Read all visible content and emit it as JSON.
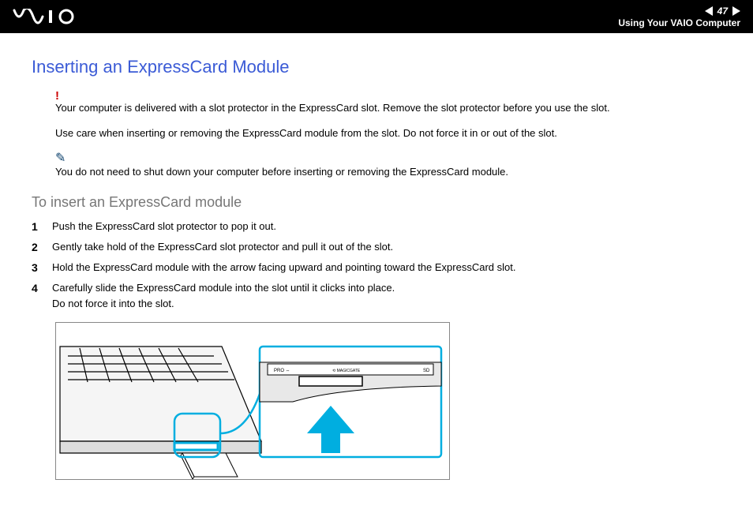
{
  "header": {
    "page_number": "47",
    "section": "Using Your VAIO Computer"
  },
  "title": "Inserting an ExpressCard Module",
  "warning1": "Your computer is delivered with a slot protector in the ExpressCard slot. Remove the slot protector before you use the slot.",
  "warning2": "Use care when inserting or removing the ExpressCard module from the slot. Do not force it in or out of the slot.",
  "tip": "You do not need to shut down your computer before inserting or removing the ExpressCard module.",
  "subhead": "To insert an ExpressCard module",
  "steps": [
    {
      "n": "1",
      "text": "Push the ExpressCard slot protector to pop it out."
    },
    {
      "n": "2",
      "text": "Gently take hold of the ExpressCard slot protector and pull it out of the slot."
    },
    {
      "n": "3",
      "text": "Hold the ExpressCard module with the arrow facing upward and pointing toward the ExpressCard slot."
    },
    {
      "n": "4",
      "text": "Carefully slide the ExpressCard module into the slot until it clicks into place.\nDo not force it into the slot."
    }
  ],
  "slot_labels": {
    "pro": "PRO",
    "mg": "MAGICGATE",
    "sd": "SD"
  }
}
